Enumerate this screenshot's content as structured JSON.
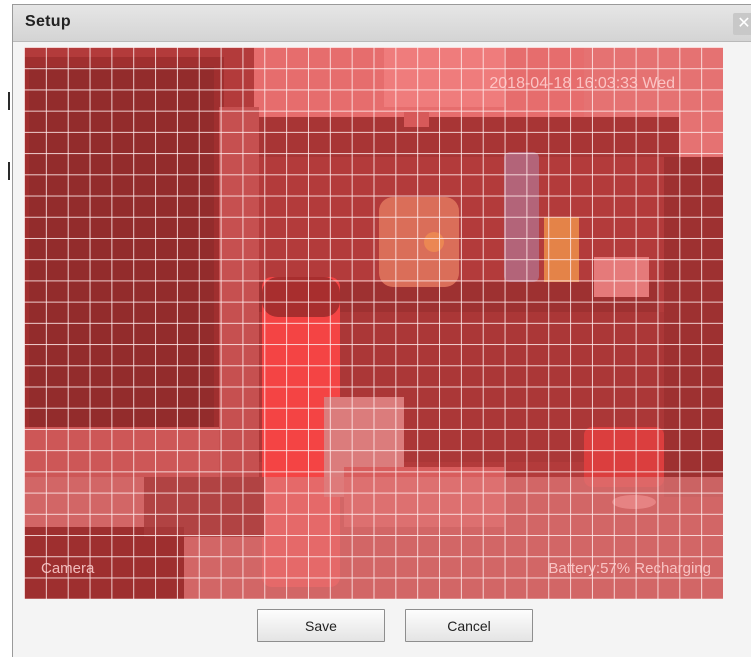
{
  "dialog": {
    "title": "Setup",
    "close_glyph": "✕"
  },
  "video": {
    "timestamp": "2018-04-18 16:03:33 Wed",
    "channel_label": "Camera",
    "battery_status": "Battery:57%  Recharging",
    "overlay_color": "#ff5a5a",
    "grid_columns": 32,
    "grid_rows": 26
  },
  "buttons": {
    "save_label": "Save",
    "cancel_label": "Cancel"
  }
}
